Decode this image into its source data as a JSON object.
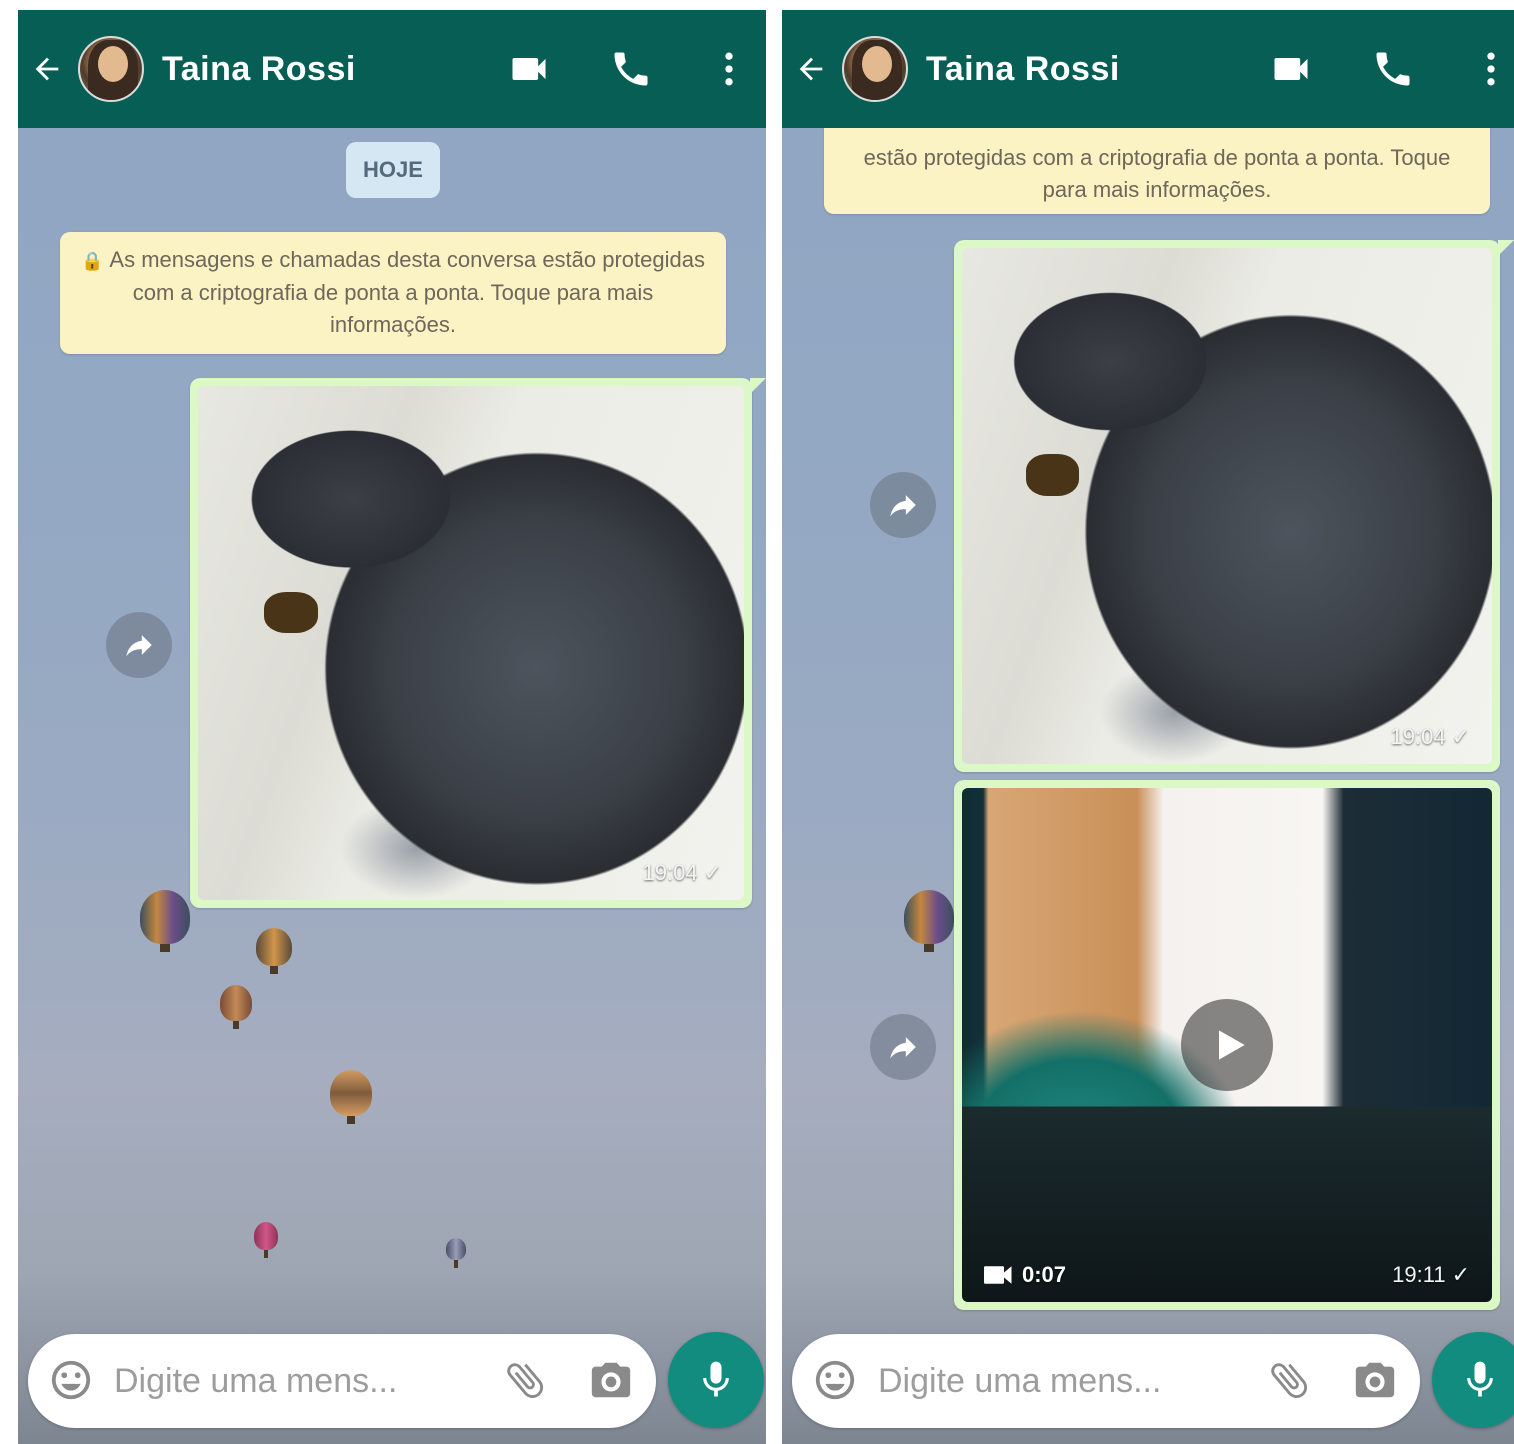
{
  "screens": [
    {
      "contact_name": "Taina Rossi",
      "date_chip": "HOJE",
      "encryption_notice": "As mensagens e chamadas desta conversa estão protegidas com a criptografia de ponta a ponta. Toque para mais informações.",
      "messages": [
        {
          "type": "image",
          "time": "19:04",
          "status": "✓"
        }
      ],
      "input_placeholder": "Digite uma mens..."
    },
    {
      "contact_name": "Taina Rossi",
      "encryption_notice_partial": "estão protegidas com a criptografia de ponta a ponta. Toque para mais informações.",
      "messages": [
        {
          "type": "image",
          "time": "19:04",
          "status": "✓"
        },
        {
          "type": "video",
          "duration": "0:07",
          "time": "19:11",
          "status": "✓"
        }
      ],
      "input_placeholder": "Digite uma mens..."
    }
  ],
  "icons": [
    "back-arrow-icon",
    "video-call-icon",
    "phone-icon",
    "more-vert-icon",
    "forward-icon",
    "play-icon",
    "emoji-icon",
    "attach-icon",
    "camera-icon",
    "mic-icon",
    "lock-icon",
    "video-camera-icon"
  ],
  "colors": {
    "header": "#075e54",
    "outgoing_bubble": "#dcf8c6",
    "system_notice": "#fcf3c4",
    "date_chip": "#d5e7f3",
    "mic_button": "#128c7e"
  }
}
